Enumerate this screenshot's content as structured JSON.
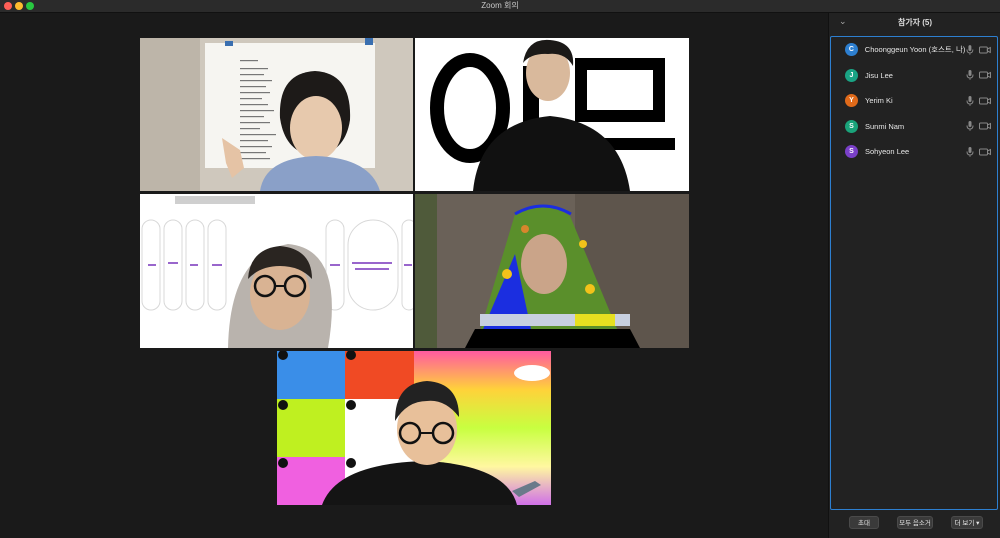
{
  "window": {
    "title": "Zoom 회의"
  },
  "participants_panel": {
    "title": "참가자 (5)",
    "participants": [
      {
        "initial": "C",
        "name": "Choonggeun Yoon (호스트, 나)",
        "color": "#2d7fd0"
      },
      {
        "initial": "J",
        "name": "Jisu Lee",
        "color": "#1aa384"
      },
      {
        "initial": "Y",
        "name": "Yerim Ki",
        "color": "#e06a1a"
      },
      {
        "initial": "S",
        "name": "Sunmi Nam",
        "color": "#1aa37a"
      },
      {
        "initial": "S",
        "name": "Sohyeon Lee",
        "color": "#7a40c8"
      }
    ],
    "footer": {
      "invite_label": "초대",
      "mute_all_label": "모두 음소거",
      "more_label": "더 보기 ▾"
    }
  },
  "video_tiles": {
    "tile2_glyphs": "이 모"
  }
}
